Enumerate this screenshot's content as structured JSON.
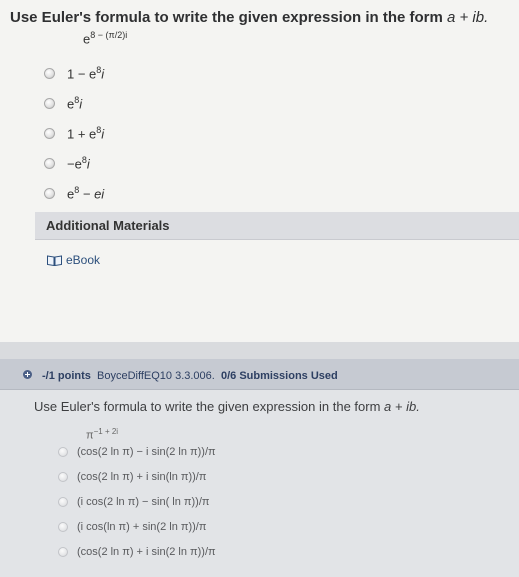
{
  "q1": {
    "prompt_main": "Use Euler's formula to write the given expression in the form ",
    "prompt_form": "a + ib.",
    "expr": {
      "base": "e",
      "exp": "8 − (π/2)i"
    },
    "choices": [
      {
        "pre": "1 − e",
        "sup": "8",
        "post": "i"
      },
      {
        "pre": "e",
        "sup": "8",
        "post": "i"
      },
      {
        "pre": "1 + e",
        "sup": "8",
        "post": "i"
      },
      {
        "pre": "−e",
        "sup": "8",
        "post": "i"
      },
      {
        "pre": "e",
        "sup": "8",
        "post": " − ei"
      }
    ],
    "additional_materials": "Additional Materials",
    "ebook": "eBook"
  },
  "q2": {
    "points": "-/1 points",
    "source": "BoyceDiffEQ10 3.3.006.",
    "submissions": "0/6 Submissions Used",
    "prompt_main": "Use Euler's formula to write the given expression in the form ",
    "prompt_form": "a + ib.",
    "expr": {
      "base": "π",
      "exp": "−1 + 2i"
    },
    "choices": [
      "(cos(2 ln π) − i sin(2 ln π))/π",
      "(cos(2 ln π) + i sin(ln π))/π",
      "(i cos(2 ln π) − sin( ln π))/π",
      "(i cos(ln π) + sin(2 ln π))/π",
      "(cos(2 ln π) + i sin(2 ln π))/π"
    ]
  },
  "colors": {
    "link": "#2c4f7c",
    "header_bg": "#c6cad2",
    "header_text": "#2d3f62"
  }
}
